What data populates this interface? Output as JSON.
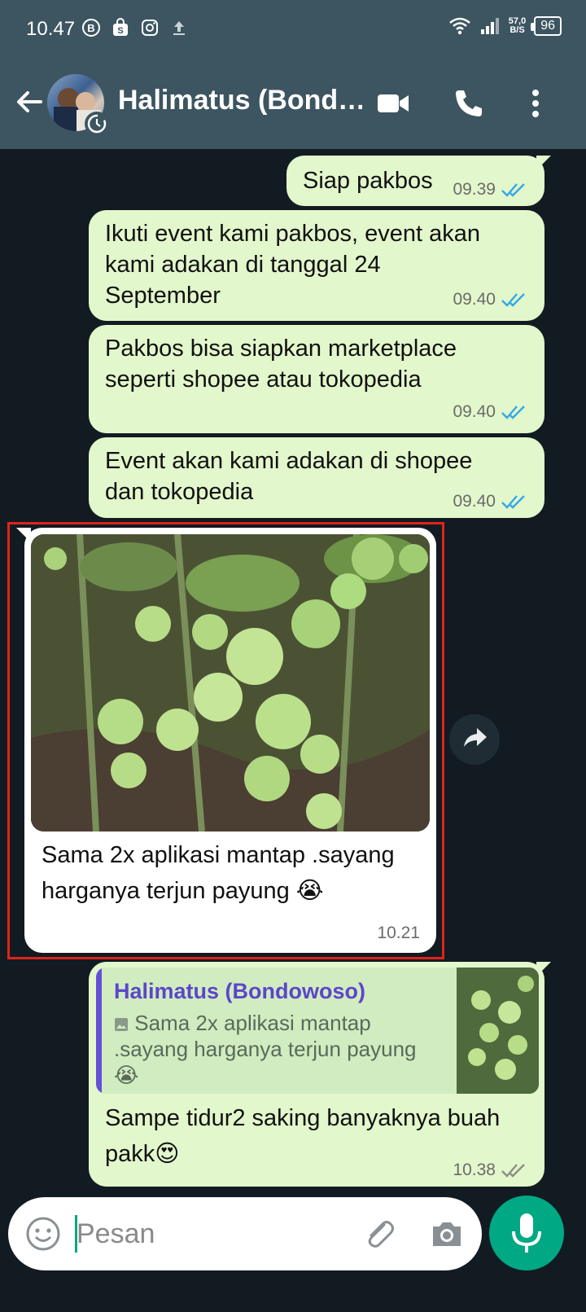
{
  "status_bar": {
    "time": "10.47",
    "speed_value": "57,0",
    "speed_unit": "B/S",
    "battery": "96"
  },
  "header": {
    "contact_name": "Halimatus (Bond…"
  },
  "messages": [
    {
      "type": "outgoing",
      "text": "Siap pakbos",
      "time": "09.39",
      "status": "read"
    },
    {
      "type": "outgoing",
      "text": "Ikuti event kami pakbos, event akan kami adakan di tanggal 24 September",
      "time": "09.40",
      "status": "read"
    },
    {
      "type": "outgoing",
      "text": "Pakbos bisa siapkan marketplace seperti shopee atau tokopedia",
      "time": "09.40",
      "status": "read"
    },
    {
      "type": "outgoing",
      "text": "Event akan kami adakan di shopee dan tokopedia",
      "time": "09.40",
      "status": "read"
    },
    {
      "type": "incoming_image",
      "caption": "Sama 2x aplikasi mantap .sayang harganya terjun payung 😭",
      "time": "10.21"
    },
    {
      "type": "outgoing_reply",
      "quote_author": "Halimatus (Bondowoso)",
      "quote_text": "Sama 2x aplikasi mantap .sayang harganya terjun payung 😭",
      "text": "Sampe tidur2 saking banyaknya buah pakk😍",
      "time": "10.38",
      "status": "delivered"
    }
  ],
  "input": {
    "placeholder": "Pesan"
  },
  "colors": {
    "header_bg": "#3c5561",
    "chat_bg": "#121b22",
    "outgoing_bubble": "#e2f7cb",
    "incoming_bubble": "#ffffff",
    "read_ticks": "#34a9e6",
    "accent": "#00a884",
    "highlight_border": "#e0231c"
  }
}
